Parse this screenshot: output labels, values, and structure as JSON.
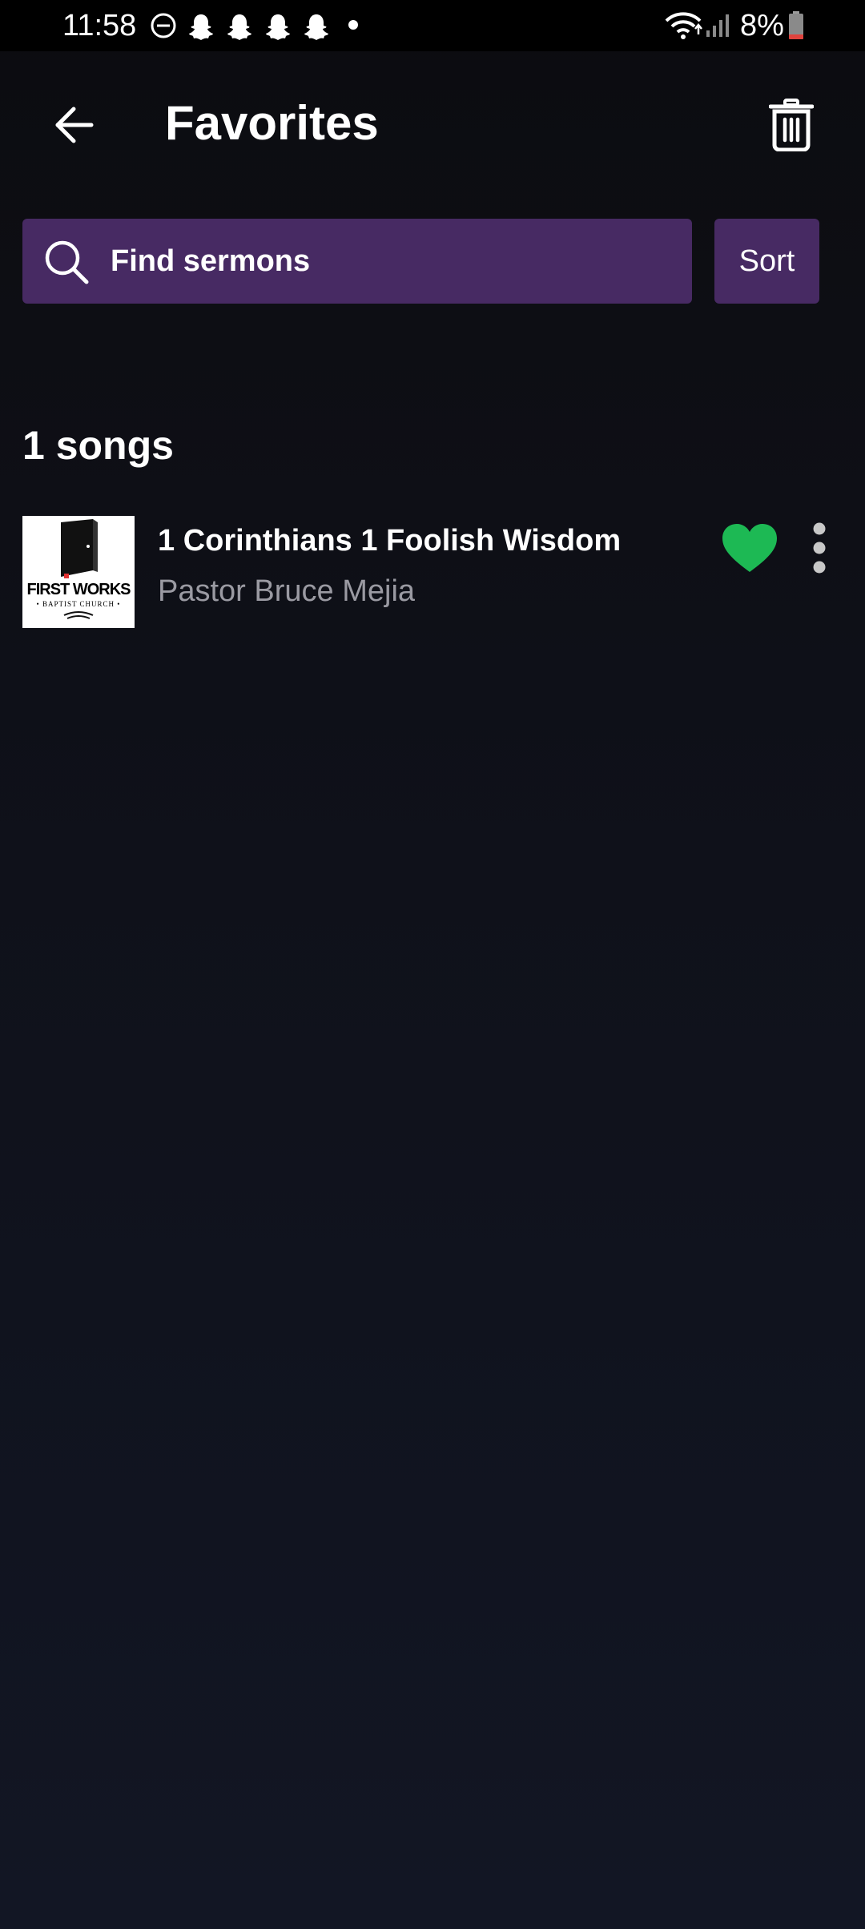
{
  "status_bar": {
    "time": "11:58",
    "battery": "8%",
    "icons": [
      "do-not-disturb-icon",
      "snapchat-icon",
      "snapchat-icon",
      "snapchat-icon",
      "snapchat-icon",
      "notification-dot-icon",
      "wifi-icon",
      "signal-icon",
      "battery-low-icon"
    ]
  },
  "header": {
    "title": "Favorites",
    "back_icon": "arrow-left-icon",
    "delete_icon": "trash-icon"
  },
  "search": {
    "placeholder": "Find sermons",
    "value": "",
    "sort_label": "Sort"
  },
  "list": {
    "count_label": "1 songs",
    "items": [
      {
        "title": "1 Corinthians 1 Foolish Wisdom",
        "subtitle": "Pastor Bruce Mejia",
        "thumbnail": {
          "name": "FIRST WORKS",
          "sub": "• BAPTIST CHURCH •"
        },
        "favorited": true
      }
    ]
  },
  "colors": {
    "accent_purple": "#472a63",
    "heart_green": "#1db954",
    "battery_red": "#e0443e",
    "subtitle_gray": "#9a9aa2"
  }
}
